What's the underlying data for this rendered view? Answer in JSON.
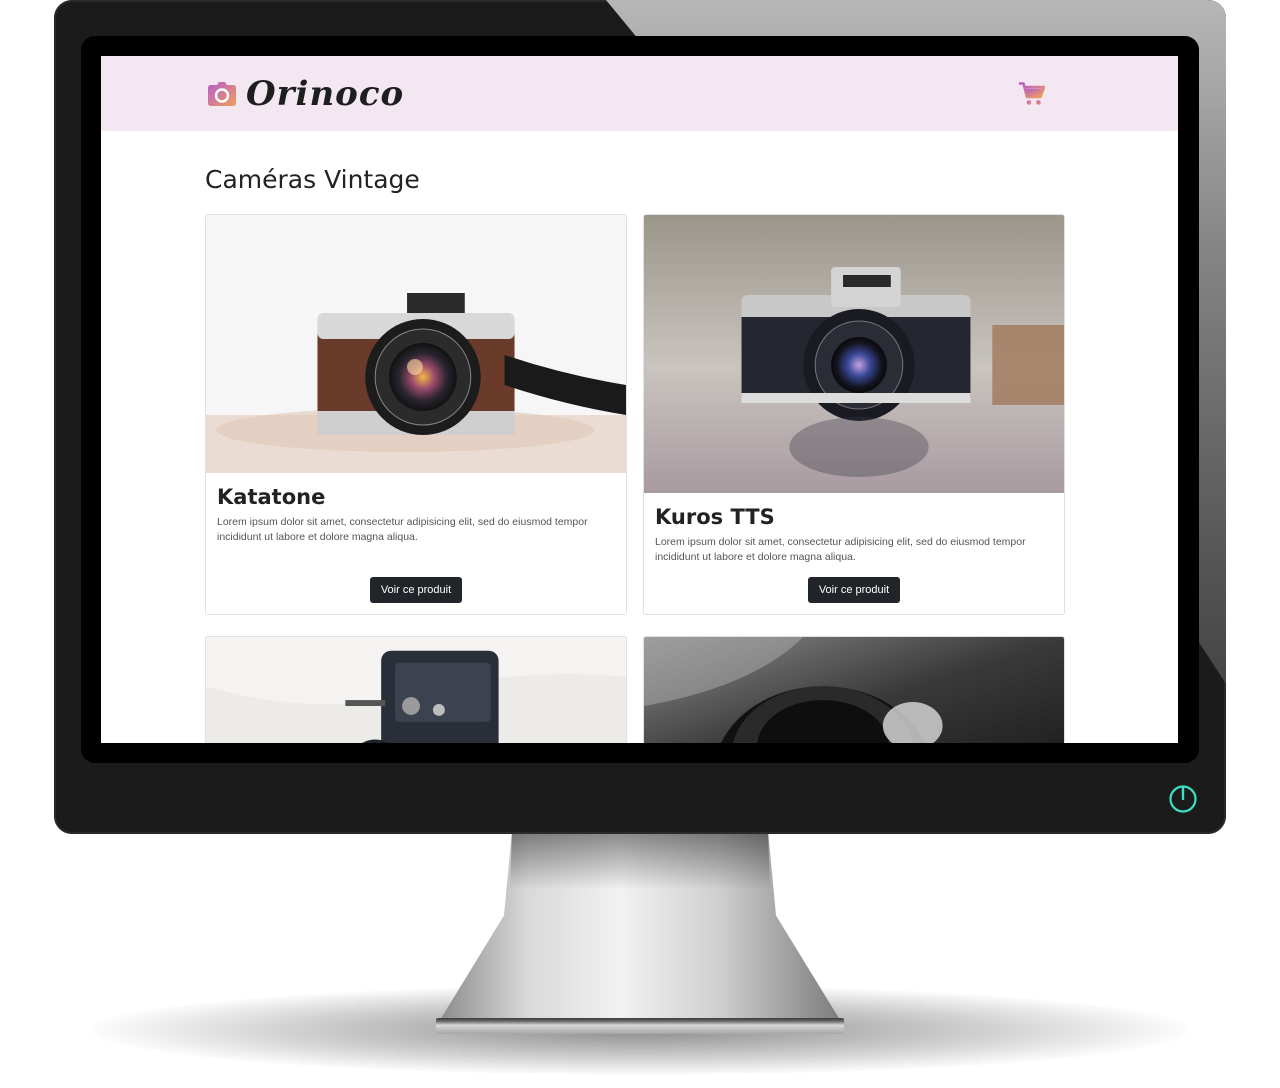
{
  "colors": {
    "header_bg": "#f3e8f1",
    "logo_gradient_start": "#c05cc8",
    "logo_gradient_end": "#f39a4a",
    "button_bg": "#212529",
    "power_accent": "#3de0c4"
  },
  "header": {
    "brand_name": "Orinoco",
    "logo_icon": "camera-icon",
    "cart_icon": "shopping-cart-icon"
  },
  "main": {
    "title": "Caméras Vintage",
    "products": [
      {
        "name": "Katatone",
        "description": "Lorem ipsum dolor sit amet, consectetur adipisicing elit, sed do eiusmod tempor incididunt ut labore et dolore magna aliqua.",
        "button_label": "Voir ce produit"
      },
      {
        "name": "Kuros TTS",
        "description": "Lorem ipsum dolor sit amet, consectetur adipisicing elit, sed do eiusmod tempor incididunt ut labore et dolore magna aliqua.",
        "button_label": "Voir ce produit"
      }
    ]
  },
  "monitor": {
    "power_icon": "power-icon"
  }
}
